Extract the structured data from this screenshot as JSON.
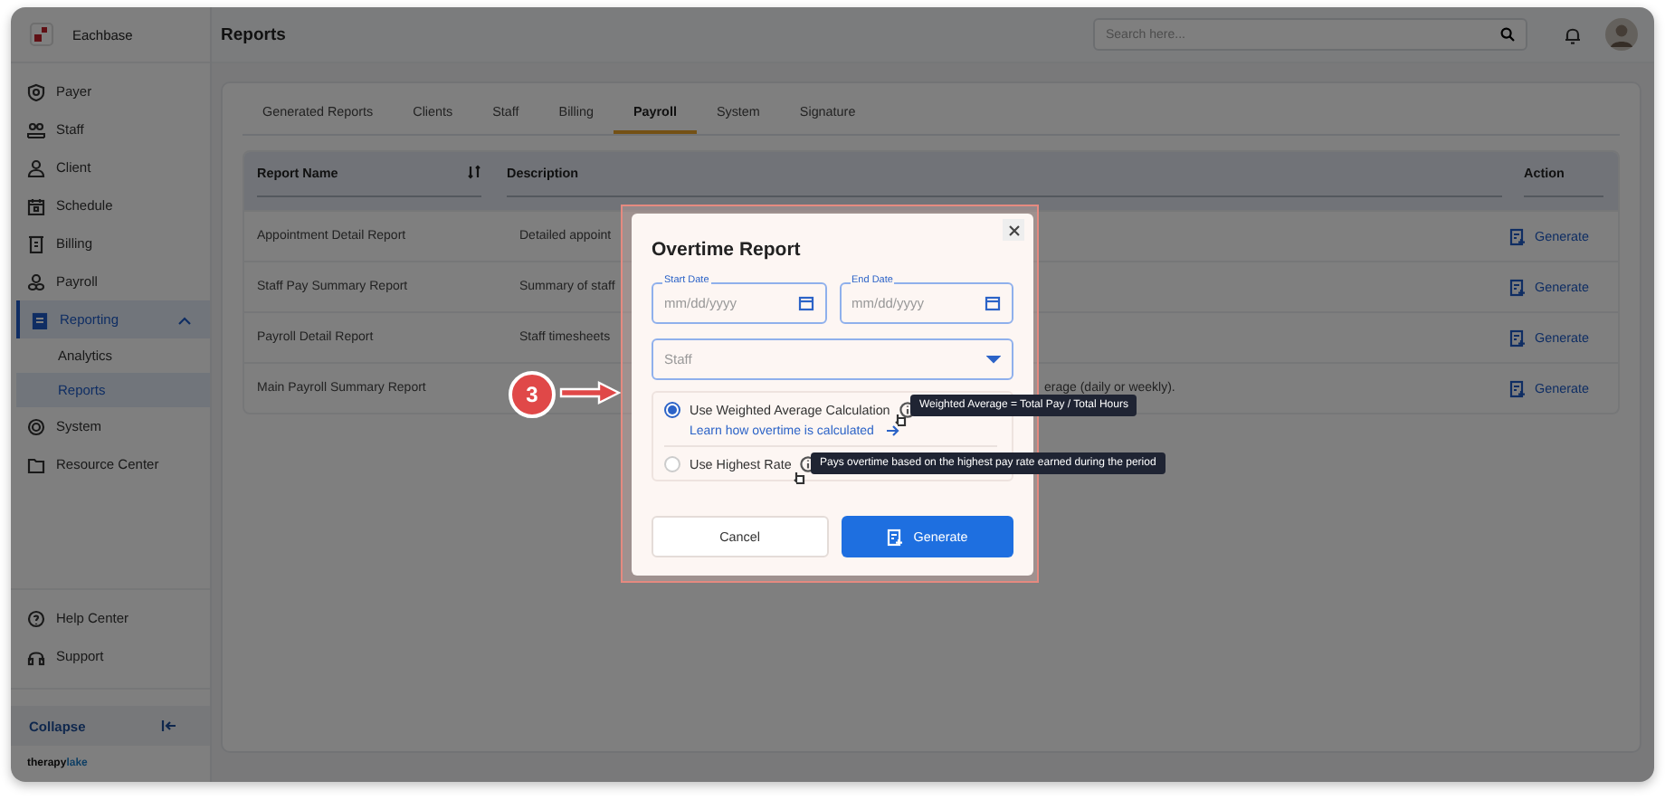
{
  "app": {
    "name": "Eachbase",
    "brand_first": "therapy",
    "brand_second": "lake"
  },
  "sidebar": {
    "items": [
      {
        "label": "Payer",
        "selected": false
      },
      {
        "label": "Staff",
        "selected": false
      },
      {
        "label": "Client",
        "selected": false
      },
      {
        "label": "Schedule",
        "selected": false
      },
      {
        "label": "Billing",
        "selected": false
      },
      {
        "label": "Payroll",
        "selected": false
      },
      {
        "label": "Reporting",
        "selected": true,
        "expanded": true,
        "children": [
          {
            "label": "Analytics",
            "selected": false
          },
          {
            "label": "Reports",
            "selected": true
          }
        ]
      },
      {
        "label": "System",
        "selected": false
      },
      {
        "label": "Resource Center",
        "selected": false
      }
    ],
    "bottom_items": [
      {
        "label": "Help Center"
      },
      {
        "label": "Support"
      }
    ],
    "collapse": "Collapse"
  },
  "header": {
    "title": "Reports",
    "search": {
      "placeholder": "Search here..."
    }
  },
  "tabs": [
    {
      "label": "Generated Reports",
      "selected": false
    },
    {
      "label": "Clients",
      "selected": false
    },
    {
      "label": "Staff",
      "selected": false
    },
    {
      "label": "Billing",
      "selected": false
    },
    {
      "label": "Payroll",
      "selected": true
    },
    {
      "label": "System",
      "selected": false
    },
    {
      "label": "Signature",
      "selected": false
    }
  ],
  "table": {
    "columns": [
      {
        "label": "Report Name",
        "sortable": true
      },
      {
        "label": "Description",
        "sortable": false
      },
      {
        "label": "Action",
        "sortable": false
      }
    ],
    "rows": [
      {
        "name": "Appointment Detail Report",
        "description": "Detailed appoint",
        "action": "Generate"
      },
      {
        "name": "Staff Pay Summary Report",
        "description": "Summary of staff",
        "action": "Generate"
      },
      {
        "name": "Payroll Detail Report",
        "description": "Staff timesheets",
        "action": "Generate"
      },
      {
        "name": "Main Payroll Summary Report",
        "description": "erage (daily or weekly).",
        "covered_start": true,
        "action": "Generate"
      }
    ]
  },
  "callout": {
    "number": "3"
  },
  "modal": {
    "title": "Overtime Report",
    "start_date": {
      "label": "Start Date",
      "placeholder": "mm/dd/yyyy"
    },
    "end_date": {
      "label": "End Date",
      "placeholder": "mm/dd/yyyy"
    },
    "staff": {
      "placeholder": "Staff"
    },
    "options": [
      {
        "label": "Use Weighted Average Calculation",
        "selected": true,
        "link": "Learn how overtime is calculated",
        "tooltip": "Weighted Average = Total Pay / Total Hours"
      },
      {
        "label": "Use Highest Rate",
        "selected": false,
        "tooltip": "Pays overtime based on the highest pay rate earned during the period"
      }
    ],
    "buttons": {
      "cancel": "Cancel",
      "generate": "Generate"
    }
  }
}
